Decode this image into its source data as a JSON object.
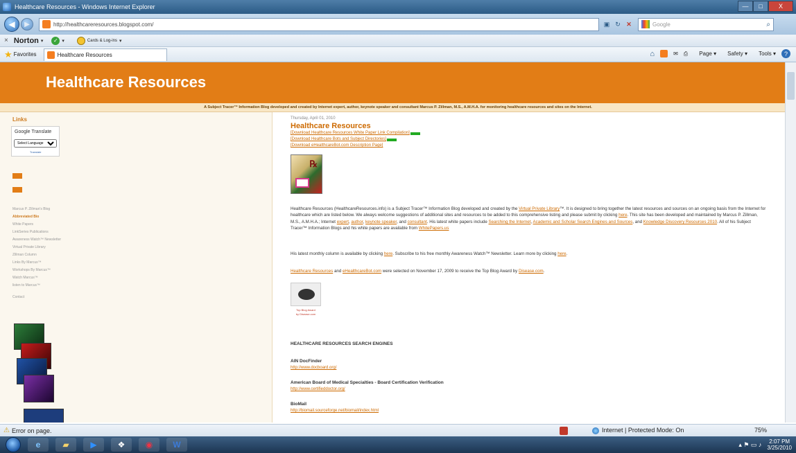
{
  "window": {
    "title": "Healthcare Resources - Windows Internet Explorer",
    "minimize": "—",
    "maximize": "□",
    "close": "X"
  },
  "address_bar": {
    "url": "http://healthcareresources.blogspot.com/",
    "search_placeholder": "Google"
  },
  "norton_toolbar": {
    "close": "×",
    "brand": "Norton",
    "cards_label": "Cards & Log-ins"
  },
  "favorites_bar": {
    "favorites_label": "Favorites",
    "tab_title": "Healthcare Resources",
    "page_menu": "Page",
    "safety_menu": "Safety",
    "tools_menu": "Tools"
  },
  "blog": {
    "title": "Healthcare Resources",
    "tagline": "A Subject Tracer™ Information Blog developed and created by Internet expert, author, keynote speaker and consultant Marcus P. Zillman, M.S., A.M.H.A. for monitoring healthcare resources and sites on the Internet."
  },
  "sidebar": {
    "heading": "Links",
    "translate_title": "Google Translate",
    "select_language": "Select Language",
    "powered_by": "Translate",
    "links": [
      "Marcus P. Zillman's Blog",
      "Abbreviated Bio",
      "White Papers",
      "LinkSeries Publications",
      "Awareness Watch™ Newsletter",
      "Virtual Private Library",
      "Zillman Column",
      "Links By Marcus™",
      "Workshops By Marcus™",
      "Watch Marcus™",
      "listen to Marcus™"
    ],
    "active_link_index": 1,
    "contact": "Contact"
  },
  "post": {
    "date": "Thursday, April 01, 2010",
    "title": "Healthcare Resources",
    "links": [
      "[Download Healthcare Resources White Paper Link Compilation]",
      "[Download Healthcare Bots and Subject Directories]",
      "[Download eHealthcareBot.com Description Page]"
    ],
    "intro_parts": {
      "a": "Healthcare Resources (HealthcareResources.info) is a Subject Tracer™ Information Blog developed and created by the ",
      "link_vpl": "Virtual Private Library",
      "b": "™. It is designed to bring together the latest resources and sources on an ongoing basis from the Internet for healthcare which are listed below. We always welcome suggestions of additional sites and resources to be added to this comprehensive listing and please submit by clicking ",
      "link_here": "here",
      "c": ". This site has been developed and maintained by Marcus P. Zillman, M.S., A.M.H.A.; Internet ",
      "link_expert": "expert",
      "link_author": "author",
      "link_keynote": "keynote speaker",
      "link_consultant": "consultant",
      "d": ". His latest white papers include ",
      "link_searching": "Searching the Internet",
      "link_academic": "Academic and Scholar Search Engines and Sources",
      "link_kd": "Knowledge Discovery Resources 2010",
      "e": ". All of his Subject Tracer™ Information Blogs and his white papers are available from ",
      "link_wp": "WhitePapers.us"
    },
    "column_parts": {
      "a": "His latest monthly column is available by clicking ",
      "link1": "here",
      "b": ". Subscribe to his free monthly Awareness Watch™ Newsletter. Learn more by clicking ",
      "link2": "here"
    },
    "award_parts": {
      "link1": "Healthcare Resources",
      "mid": " and ",
      "link2": "eHealthcareBot.com",
      "b": " were selected on November 17, 2009 to receive the Top Blog Award by ",
      "link3": "Disease.com"
    },
    "award_caption_1": "Top Blog Award",
    "award_caption_2": "by Disease.com",
    "section_heading": "HEALTHCARE RESOURCES SEARCH ENGINES",
    "entries": [
      {
        "name": "AIN DocFinder",
        "url": "http://www.docboard.org/"
      },
      {
        "name": "American Board of Medical Specialties - Board Certification Verification",
        "url": "http://www.certifieddoctor.org/"
      },
      {
        "name": "BioMail",
        "url": "http://biomail.sourceforge.net/biomail/index.html"
      }
    ]
  },
  "status_bar": {
    "error": "Error on page.",
    "zone": "Internet | Protected Mode: On",
    "zoom": "75%"
  },
  "taskbar": {
    "time": "2:07 PM",
    "date": "3/25/2010"
  }
}
